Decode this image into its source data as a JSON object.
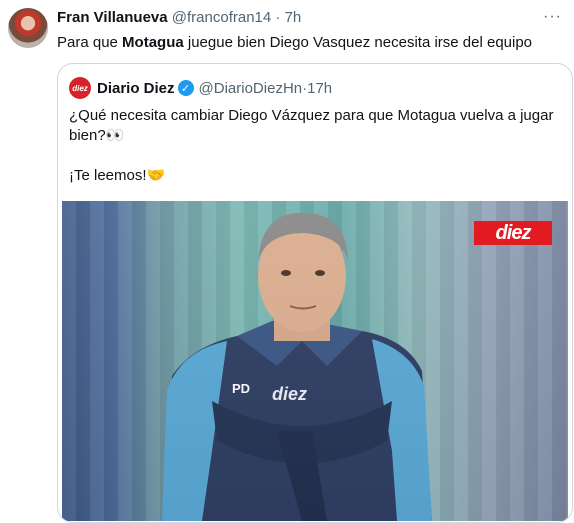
{
  "tweet": {
    "display_name": "Fran Villanueva",
    "handle": "@francofran14",
    "separator": "·",
    "time": "7h",
    "more_icon": "more-horizontal-icon",
    "text_before": "Para que ",
    "text_bold": "Motagua",
    "text_after": " juegue bien Diego Vasquez necesita irse del equipo"
  },
  "quoted": {
    "avatar_text": "diez",
    "display_name": "Diario Diez",
    "verified_icon": "verified-badge-icon",
    "handle": "@DiarioDiezHn",
    "separator": "·",
    "time": "17h",
    "line1": "¿Qué necesita cambiar Diego Vázquez para que Motagua vuelva a jugar",
    "line2": "bien?👀",
    "line3": "¡Te leemos!🤝",
    "media": {
      "logo_text": "diez",
      "shirt_text": "diez",
      "brand_color": "#e21b23"
    }
  },
  "colors": {
    "accent": "#1d9bf0",
    "muted": "#536471",
    "border": "#cfd9de"
  }
}
